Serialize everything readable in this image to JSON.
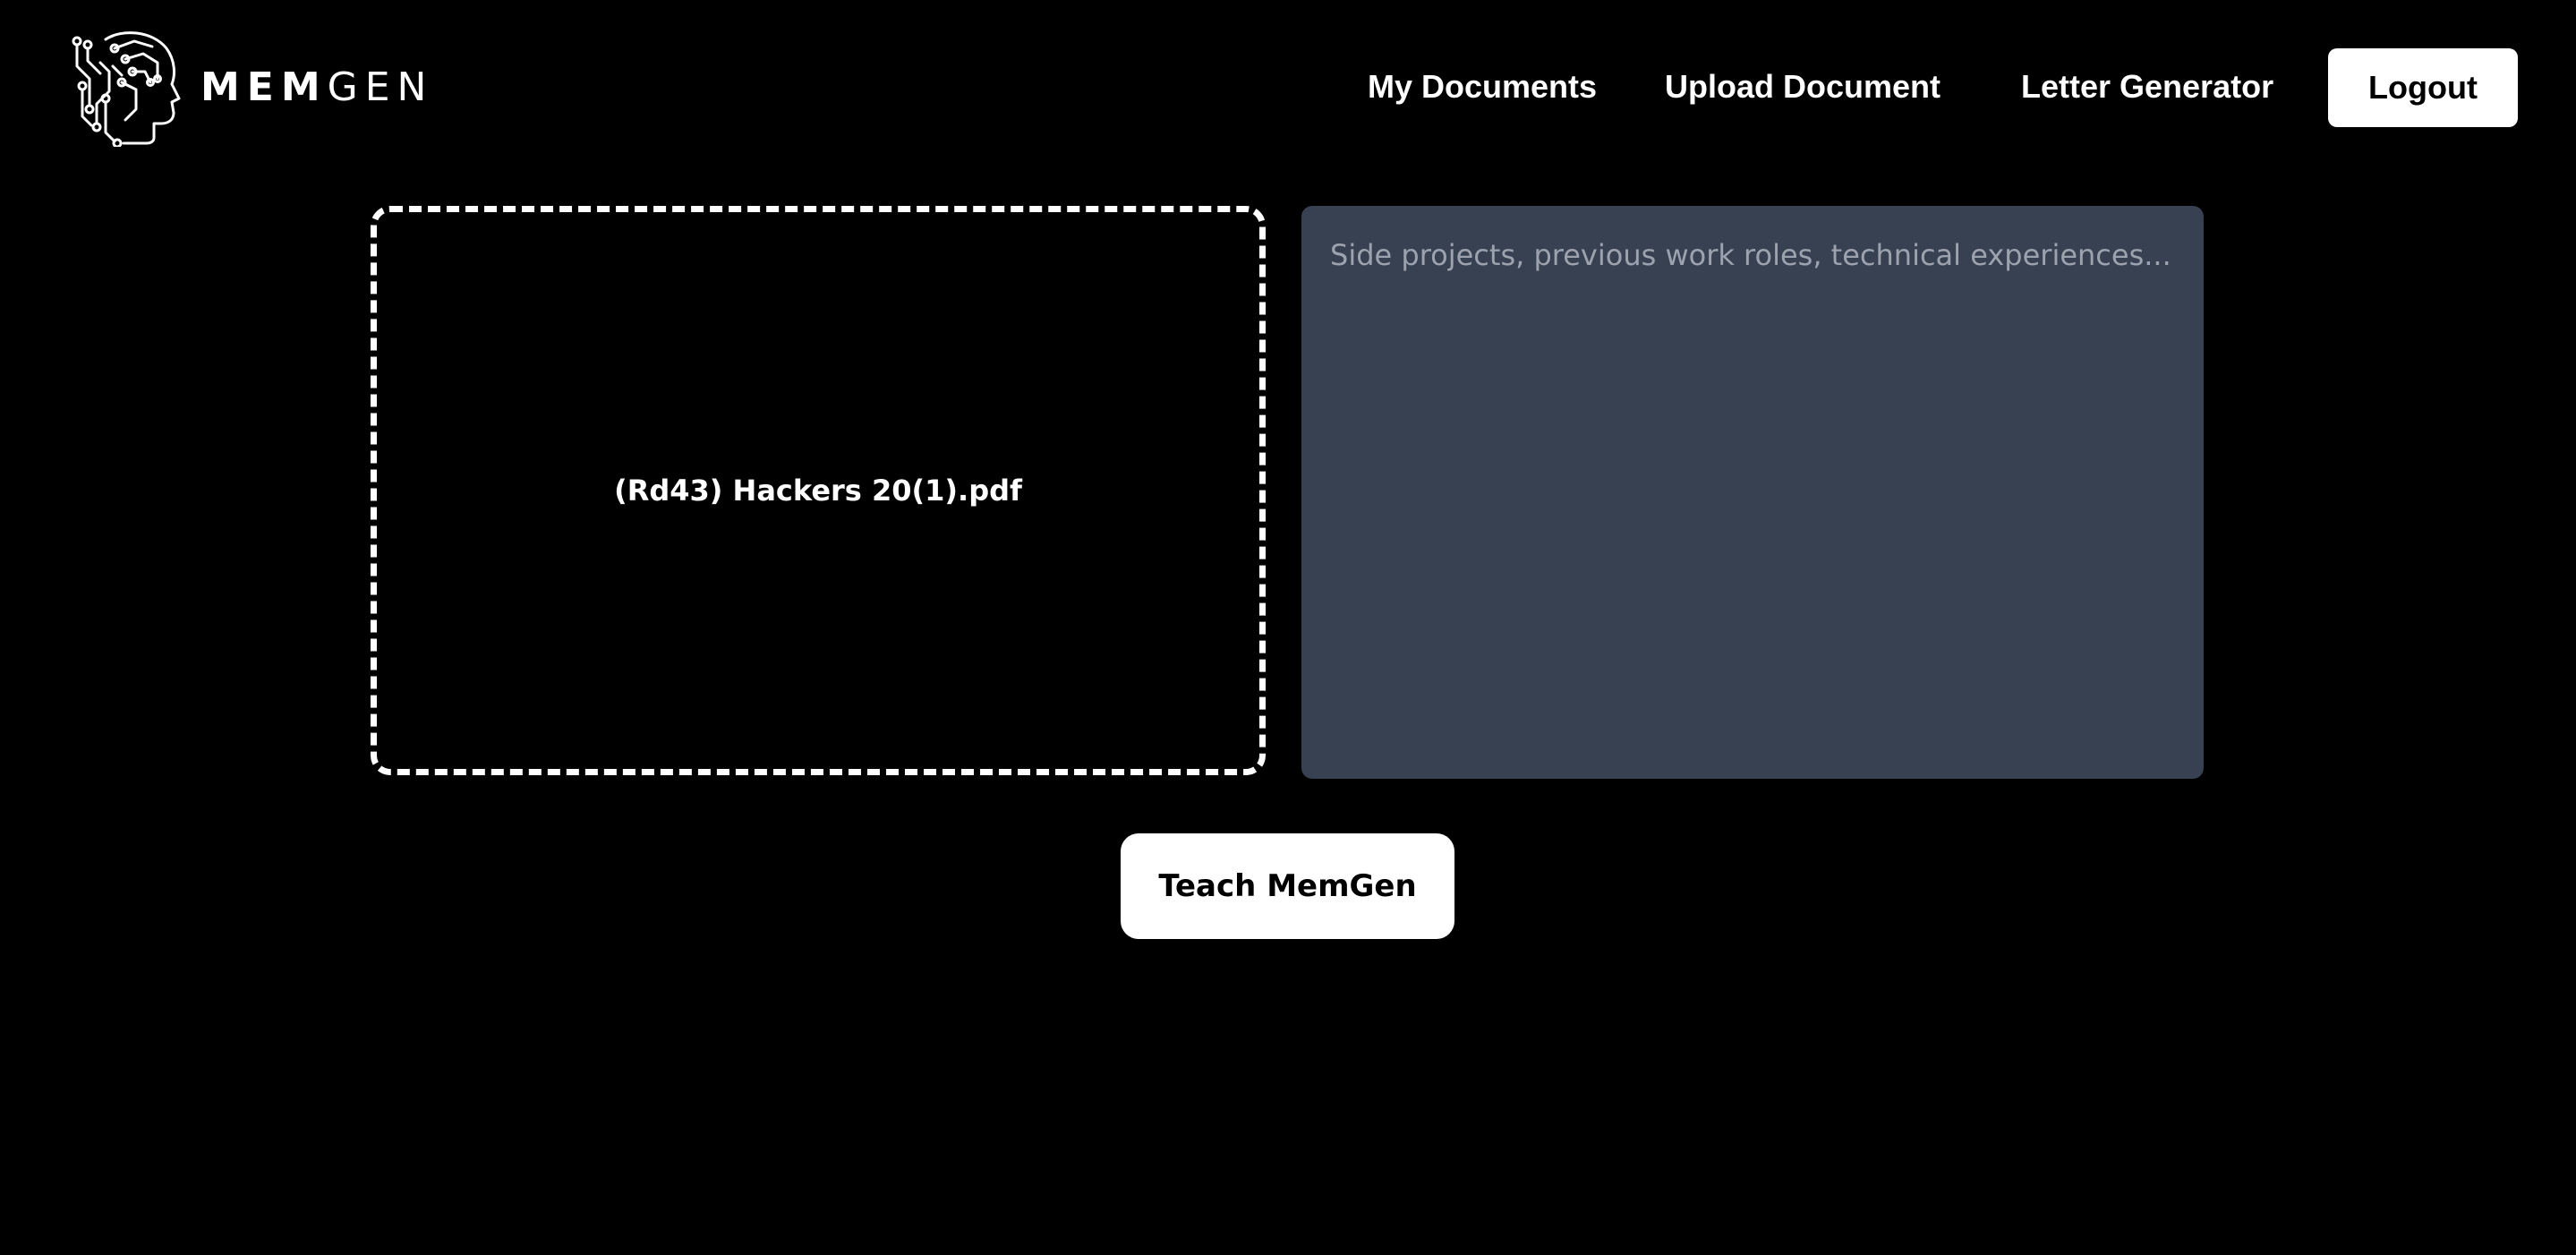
{
  "brand": {
    "icon": "ai-head-circuit-icon",
    "word_bold": "MEM",
    "word_light": "GEN"
  },
  "nav": {
    "my_documents": "My Documents",
    "upload_document": "Upload Document",
    "letter_generator": "Letter Generator",
    "logout": "Logout"
  },
  "upload": {
    "file_name": "(Rd43) Hackers 20(1).pdf"
  },
  "notes": {
    "value": "",
    "placeholder": "Side projects, previous work roles, technical experiences..."
  },
  "actions": {
    "teach": "Teach MemGen"
  },
  "colors": {
    "background": "#000000",
    "text": "#ffffff",
    "textarea_bg": "#374151",
    "placeholder": "#9ca3af",
    "button_bg": "#ffffff",
    "button_text": "#000000"
  }
}
